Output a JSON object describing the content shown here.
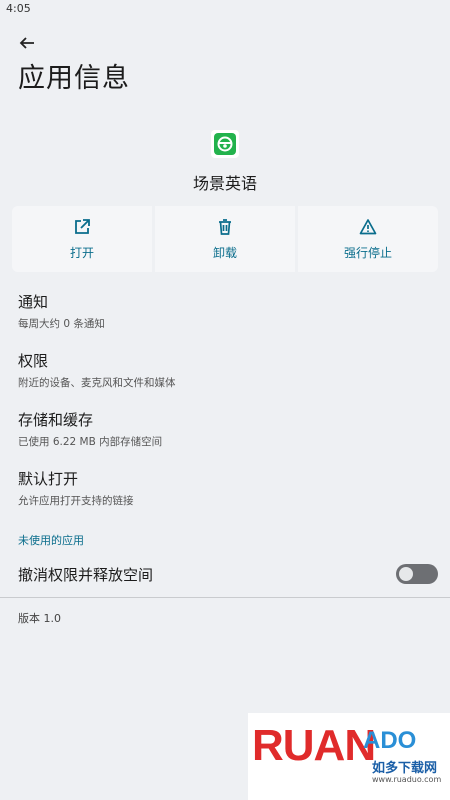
{
  "status_bar": {
    "time": "4:05"
  },
  "header": {
    "title": "应用信息"
  },
  "app": {
    "name": "场景英语",
    "icon": "steering-wheel-icon",
    "icon_bg": "#22b24c"
  },
  "actions": [
    {
      "label": "打开",
      "icon": "open-external-icon"
    },
    {
      "label": "卸载",
      "icon": "trash-icon"
    },
    {
      "label": "强行停止",
      "icon": "warning-icon"
    }
  ],
  "settings": [
    {
      "title": "通知",
      "subtitle": "每周大约 0 条通知"
    },
    {
      "title": "权限",
      "subtitle": "附近的设备、麦克风和文件和媒体"
    },
    {
      "title": "存储和缓存",
      "subtitle": "已使用 6.22 MB 内部存储空间"
    },
    {
      "title": "默认打开",
      "subtitle": "允许应用打开支持的链接"
    }
  ],
  "unused_section": {
    "header": "未使用的应用",
    "toggle_label": "撤消权限并释放空间",
    "toggle_on": false
  },
  "version": "版本 1.0",
  "watermark": {
    "text_big": "RUAN",
    "text_ado": "ADO",
    "text_cn": "如多下载网",
    "url": "www.ruaduo.com"
  },
  "colors": {
    "accent": "#0a6d8c",
    "background": "#eef0f3"
  }
}
